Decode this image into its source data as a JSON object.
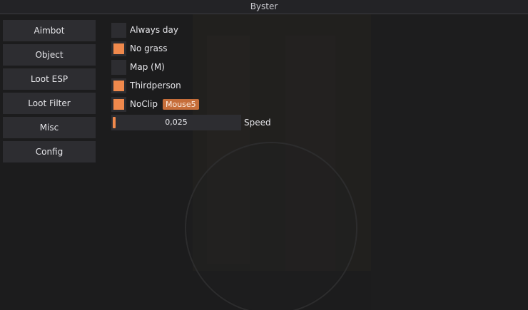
{
  "window": {
    "title": "Byster"
  },
  "sidebar": {
    "items": [
      {
        "label": "Aimbot"
      },
      {
        "label": "Object"
      },
      {
        "label": "Loot ESP"
      },
      {
        "label": "Loot Filter"
      },
      {
        "label": "Misc"
      },
      {
        "label": "Config"
      }
    ]
  },
  "options": [
    {
      "label": "Always day",
      "checked": false
    },
    {
      "label": "No grass",
      "checked": true
    },
    {
      "label": "Map (M)",
      "checked": false
    },
    {
      "label": "Thirdperson",
      "checked": true
    },
    {
      "label": "NoClip",
      "checked": true,
      "keybind": "Mouse5"
    }
  ],
  "speed": {
    "label": "Speed",
    "value": "0,025"
  },
  "colors": {
    "accent": "#f0894c",
    "keybind": "#c66e3a",
    "control_bg": "#2d2d31",
    "window_bg": "#1c1c1d"
  }
}
